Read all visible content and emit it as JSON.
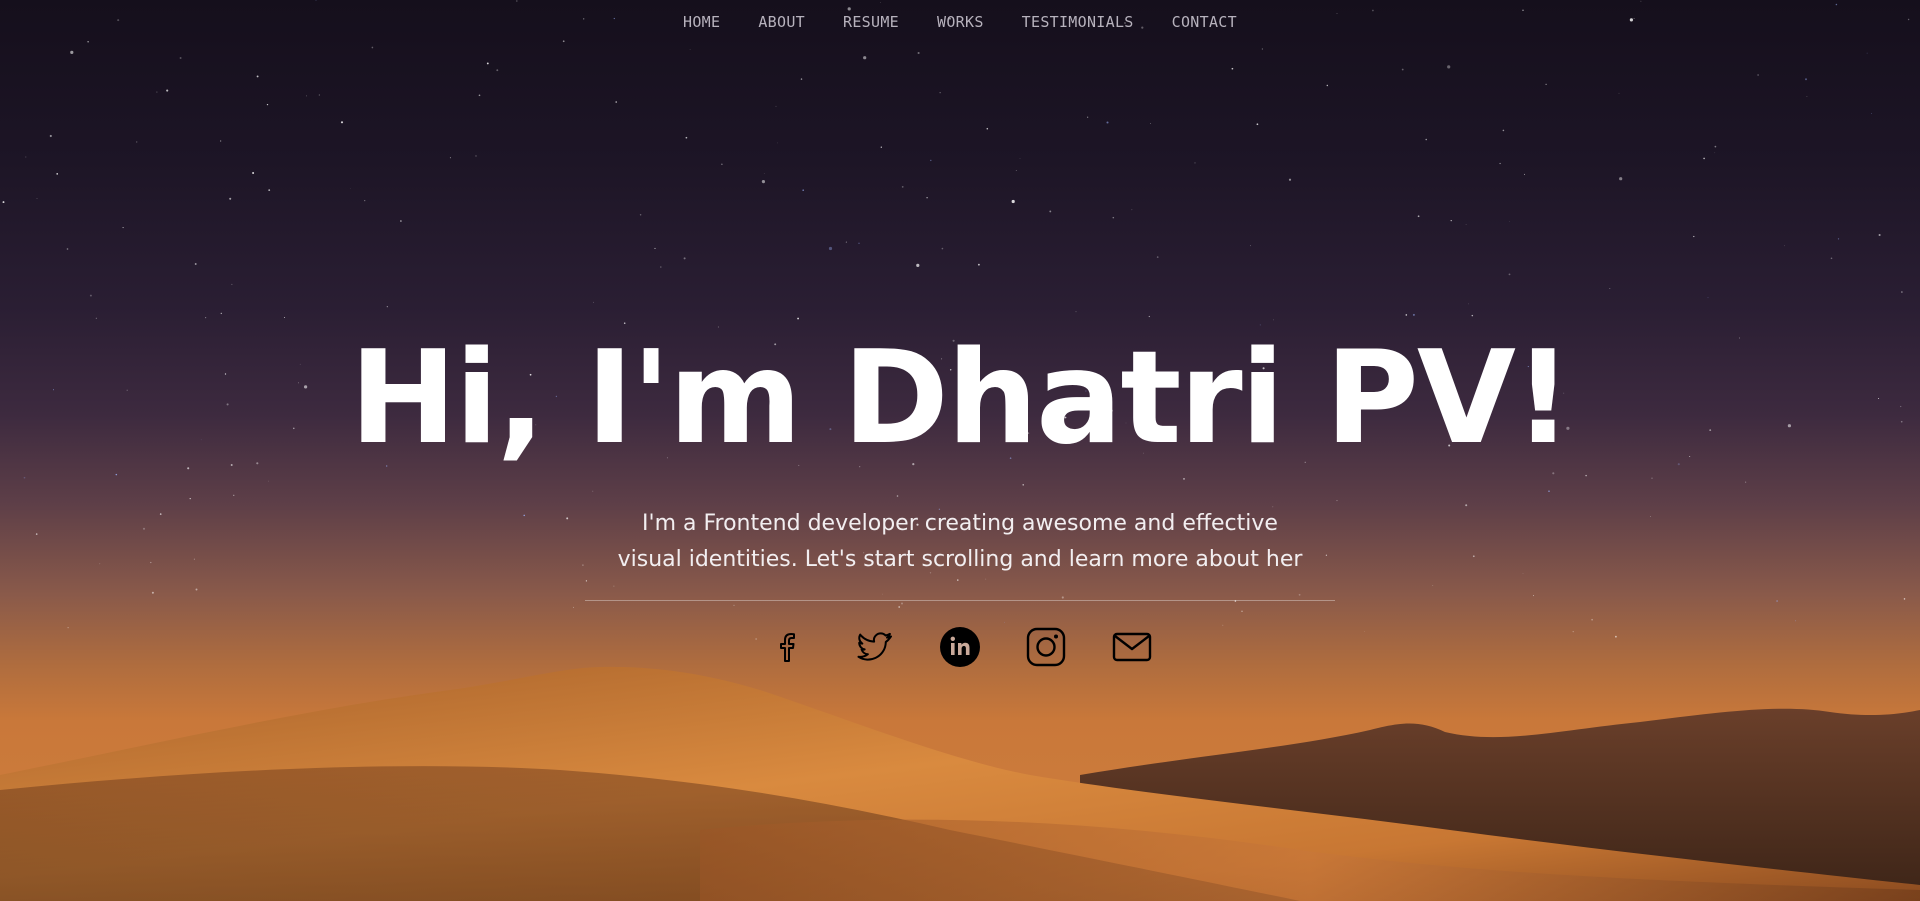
{
  "nav": {
    "items": [
      {
        "label": "HOME"
      },
      {
        "label": "ABOUT"
      },
      {
        "label": "RESUME"
      },
      {
        "label": "WORKS"
      },
      {
        "label": "TESTIMONIALS"
      },
      {
        "label": "CONTACT"
      }
    ]
  },
  "hero": {
    "headline": "Hi, I'm Dhatri PV!",
    "intro": "I'm a Frontend developer creating awesome and effective visual identities. Let's start scrolling and learn more about her"
  },
  "social": {
    "icons": [
      "facebook-icon",
      "twitter-icon",
      "linkedin-icon",
      "instagram-icon",
      "mail-icon"
    ]
  },
  "colors": {
    "sky_top": "#150f1c",
    "horizon": "#c9783a",
    "dune": "#d07f3d",
    "icon": "#000000",
    "text": "#ffffff"
  }
}
